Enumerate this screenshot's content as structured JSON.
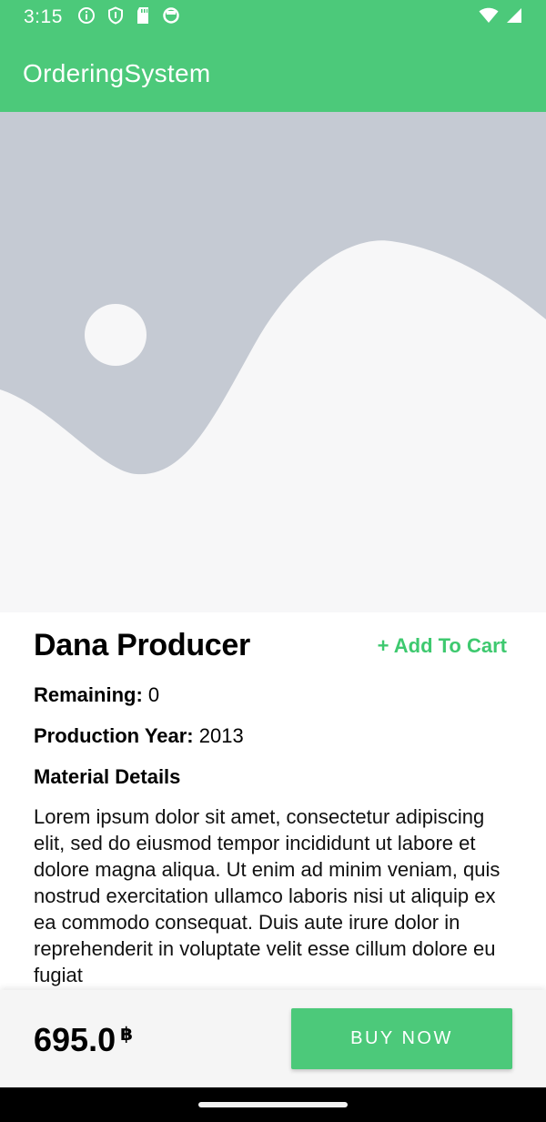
{
  "status_bar": {
    "time": "3:15",
    "icons": [
      "info-icon",
      "shield-icon",
      "sd-card-icon",
      "sync-icon",
      "wifi-icon",
      "signal-icon"
    ]
  },
  "app_bar": {
    "title": "OrderingSystem"
  },
  "product": {
    "image": "placeholder-image",
    "name": "Dana Producer",
    "add_to_cart_label": "+ Add To Cart",
    "remaining_label": "Remaining:",
    "remaining_value": "0",
    "production_year_label": "Production Year:",
    "production_year_value": "2013",
    "material_details_label": "Material Details",
    "description": "Lorem ipsum dolor sit amet, consectetur adipiscing elit, sed do eiusmod tempor incididunt ut labore et dolore magna aliqua. Ut enim ad minim veniam, quis nostrud exercitation ullamco laboris nisi ut aliquip ex ea commodo consequat. Duis aute irure dolor in reprehenderit in voluptate velit esse cillum dolore eu fugiat"
  },
  "bottom_bar": {
    "price": "695.0",
    "currency": "฿",
    "buy_now_label": "BUY NOW"
  },
  "colors": {
    "primary": "#4cc97a",
    "accent_text": "#3ec96f",
    "placeholder_background": "#c5cad3",
    "placeholder_shape": "#f7f7f8"
  }
}
